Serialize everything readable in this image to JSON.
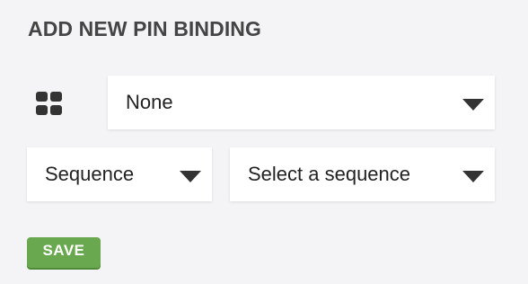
{
  "panel": {
    "title": "ADD NEW PIN BINDING"
  },
  "pin_select": {
    "icon": "grid-icon",
    "value": "None"
  },
  "binding_type_select": {
    "value": "Sequence"
  },
  "sequence_select": {
    "value": "Select a sequence"
  },
  "actions": {
    "save_label": "SAVE",
    "save_color": "#6aa84f"
  }
}
